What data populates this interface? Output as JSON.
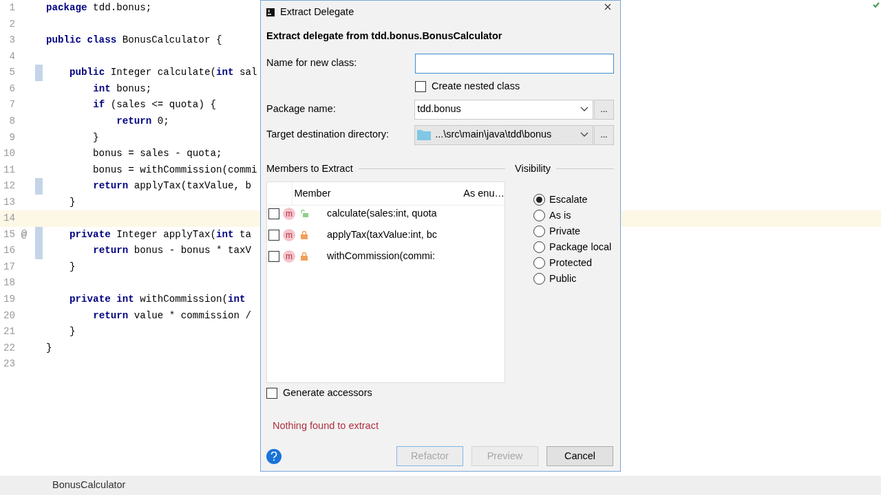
{
  "editor": {
    "lines": [
      {
        "number": "1",
        "code": "**package** tdd.bonus;",
        "changed": false,
        "current": false
      },
      {
        "number": "2",
        "changed": false,
        "current": false
      },
      {
        "number": "3",
        "code": "**public class** BonusCalculator {",
        "changed": false,
        "current": false
      },
      {
        "number": "4",
        "changed": false,
        "current": false
      },
      {
        "number": "5",
        "code": "    **public** Integer calculate(**int** sal",
        "changed": true,
        "current": false
      },
      {
        "number": "6",
        "code": "        **int** bonus;",
        "changed": false,
        "current": false
      },
      {
        "number": "7",
        "code": "        **if** (sales <= quota) {",
        "changed": false,
        "current": false
      },
      {
        "number": "8",
        "code": "            **return** 0;",
        "changed": false,
        "current": false
      },
      {
        "number": "9",
        "code": "        }",
        "changed": false,
        "current": false
      },
      {
        "number": "10",
        "code": "        bonus = sales - quota;",
        "changed": false,
        "current": false
      },
      {
        "number": "11",
        "code": "        bonus = withCommission(commi",
        "changed": false,
        "current": false
      },
      {
        "number": "12",
        "code": "        **return** applyTax(taxValue, b",
        "changed": true,
        "current": false
      },
      {
        "number": "13",
        "code": "    }",
        "changed": false,
        "current": false
      },
      {
        "number": "14",
        "changed": false,
        "current": true
      },
      {
        "number": "15",
        "code": "    **private** Integer applyTax(**int** ta",
        "changed": true,
        "current": false,
        "mark": "@"
      },
      {
        "number": "16",
        "code": "        **return** bonus - bonus * taxV",
        "changed": true,
        "current": false
      },
      {
        "number": "17",
        "code": "    }",
        "changed": false,
        "current": false
      },
      {
        "number": "18",
        "changed": false,
        "current": false
      },
      {
        "number": "19",
        "code": "    **private int** withCommission(**int**",
        "changed": false,
        "current": false
      },
      {
        "number": "20",
        "code": "        **return** value * commission /",
        "changed": false,
        "current": false
      },
      {
        "number": "21",
        "code": "    }",
        "changed": false,
        "current": false
      },
      {
        "number": "22",
        "code": "}",
        "changed": false,
        "current": false
      },
      {
        "number": "23",
        "changed": false,
        "current": false
      }
    ]
  },
  "dialog": {
    "title": "Extract Delegate",
    "heading": "Extract delegate from tdd.bonus.BonusCalculator",
    "name_field": {
      "label": "Name for new class:",
      "focused": true
    },
    "nested_class": {
      "label": "Create nested class",
      "checked": false
    },
    "package_field": {
      "label": "Package name:",
      "value": "tdd.bonus",
      "browse": "..."
    },
    "directory_field": {
      "label": "Target destination directory:",
      "value": "...\\src\\main\\java\\tdd\\bonus",
      "browse": "..."
    },
    "members": {
      "title": "Members to Extract",
      "columns": [
        "Member",
        "As enu…"
      ],
      "rows": [
        {
          "badge": "m",
          "locked": false,
          "text": "calculate(sales:int, quota",
          "checked": false
        },
        {
          "badge": "m",
          "locked": true,
          "text": "applyTax(taxValue:int, bc",
          "checked": false
        },
        {
          "badge": "m",
          "locked": true,
          "text": "withCommission(commi:",
          "checked": false
        }
      ]
    },
    "visibility": {
      "title": "Visibility",
      "options": [
        {
          "label": "Escalate",
          "selected": true
        },
        {
          "label": "As is",
          "selected": false
        },
        {
          "label": "Private",
          "selected": false
        },
        {
          "label": "Package local",
          "selected": false
        },
        {
          "label": "Protected",
          "selected": false
        },
        {
          "label": "Public",
          "selected": false
        }
      ]
    },
    "generate_accessors": {
      "label": "Generate accessors",
      "checked": false
    },
    "error": "Nothing found to extract",
    "buttons": [
      {
        "label": "Refactor",
        "disabled": true,
        "focused": true
      },
      {
        "label": "Preview",
        "disabled": true,
        "focused": false
      },
      {
        "label": "Cancel",
        "disabled": false,
        "focused": false
      }
    ]
  },
  "status_bar": {
    "file": "BonusCalculator"
  }
}
